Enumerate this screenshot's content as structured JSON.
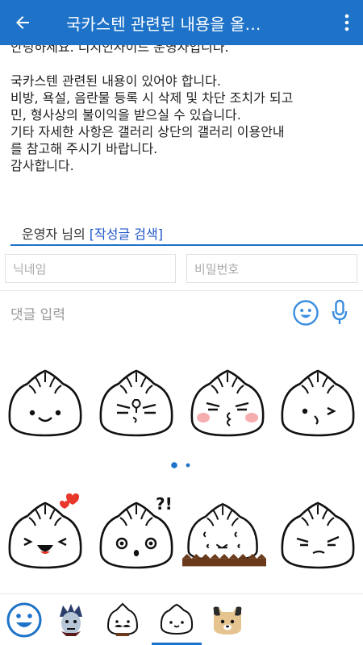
{
  "appbar": {
    "title": "국카스텐 관련된 내용을 올…"
  },
  "article": {
    "line1": "안녕하세요. 디시인사이드 운영자입니다.",
    "line2": "국카스텐 관련된 내용이 있어야 합니다.",
    "line3": "비방, 욕설, 음란물 등록 시 삭제 및 차단 조치가 되고",
    "line4": "민, 형사상의 불이익을 받으실 수 있습니다.",
    "line5": "기타 자세한 사항은 갤러리 상단의 갤러리 이용안내",
    "line6": "를 참고해 주시기 바랍니다.",
    "line7": "감사합니다."
  },
  "author": {
    "prefix": "운영자 님의 ",
    "link": "[작성글 검색]"
  },
  "comment_form": {
    "nickname_placeholder": "닉네임",
    "password_placeholder": "비밀번호",
    "comment_placeholder": "댓글 입력"
  },
  "stickers": {
    "page_count": 2,
    "active_page": 1,
    "items": [
      "dumpling-smile",
      "dumpling-pout",
      "dumpling-blush-kiss",
      "dumpling-wink",
      "dumpling-love-laugh",
      "dumpling-surprised",
      "dumpling-sitting",
      "dumpling-smirk"
    ]
  },
  "sticker_tabs": [
    "emoji-smile-icon",
    "vampire-sticker-icon",
    "mustache-dumpling-icon",
    "dumpling-icon",
    "puppy-icon"
  ],
  "colors": {
    "accent": "#1e73c9",
    "link": "#1e56c9",
    "dot_active": "#1e73c9",
    "blush": "#f28a8a",
    "heart": "#e8372b"
  }
}
